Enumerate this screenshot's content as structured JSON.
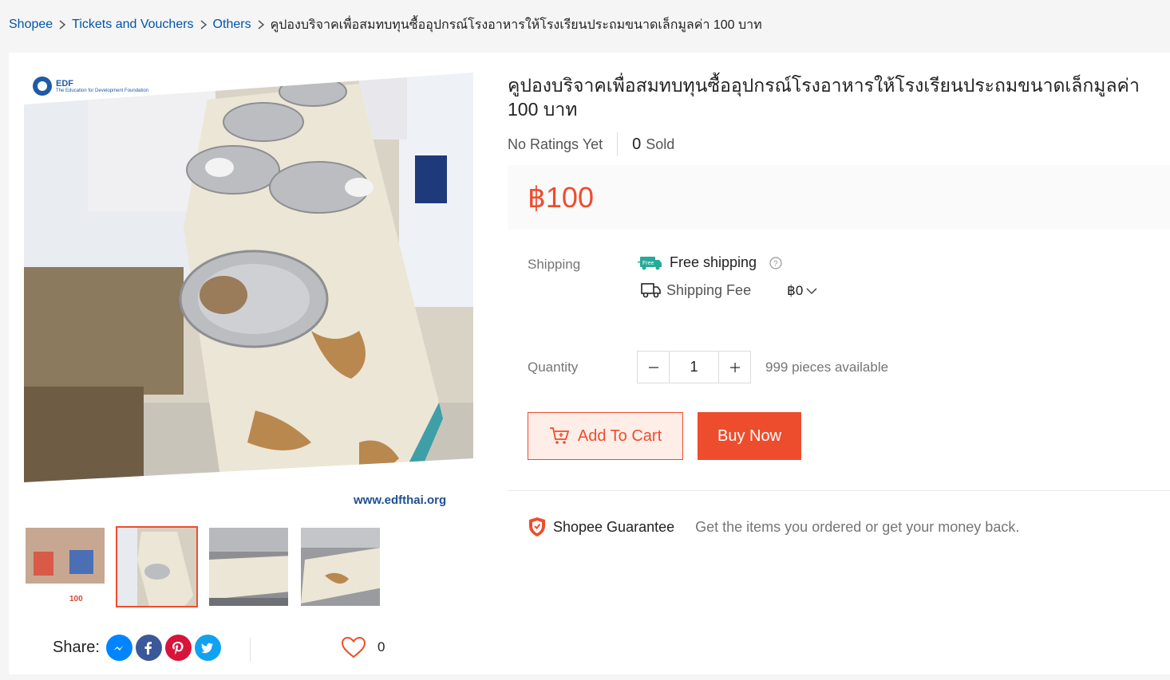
{
  "breadcrumb": {
    "items": [
      "Shopee",
      "Tickets and Vouchers",
      "Others"
    ],
    "current": "คูปองบริจาคเพื่อสมทบทุนซื้ออุปกรณ์โรงอาหารให้โรงเรียนประถมขนาดเล็กมูลค่า 100 บาท"
  },
  "product": {
    "title": "คูปองบริจาคเพื่อสมทบทุนซื้ออุปกรณ์โรงอาหารให้โรงเรียนประถมขนาดเล็กมูลค่า 100 บาท",
    "ratings_text": "No Ratings Yet",
    "sold_count": "0",
    "sold_label": "Sold",
    "price": "฿100",
    "image_watermark": "www.edfthai.org",
    "image_logo": "EDF",
    "image_logo_sub": "The Education for Development Foundation",
    "thumb1_text": "100"
  },
  "shipping": {
    "label": "Shipping",
    "free_badge": "Free",
    "free_text": "Free shipping",
    "fee_label": "Shipping Fee",
    "fee_value": "฿0"
  },
  "quantity": {
    "label": "Quantity",
    "value": "1",
    "available": "999 pieces available"
  },
  "actions": {
    "add_to_cart": "Add To Cart",
    "buy_now": "Buy Now"
  },
  "guarantee": {
    "title": "Shopee Guarantee",
    "text": "Get the items you ordered or get your money back."
  },
  "share": {
    "label": "Share:",
    "like_count": "0"
  },
  "colors": {
    "accent": "#ee4d2d",
    "link": "#0055aa"
  }
}
